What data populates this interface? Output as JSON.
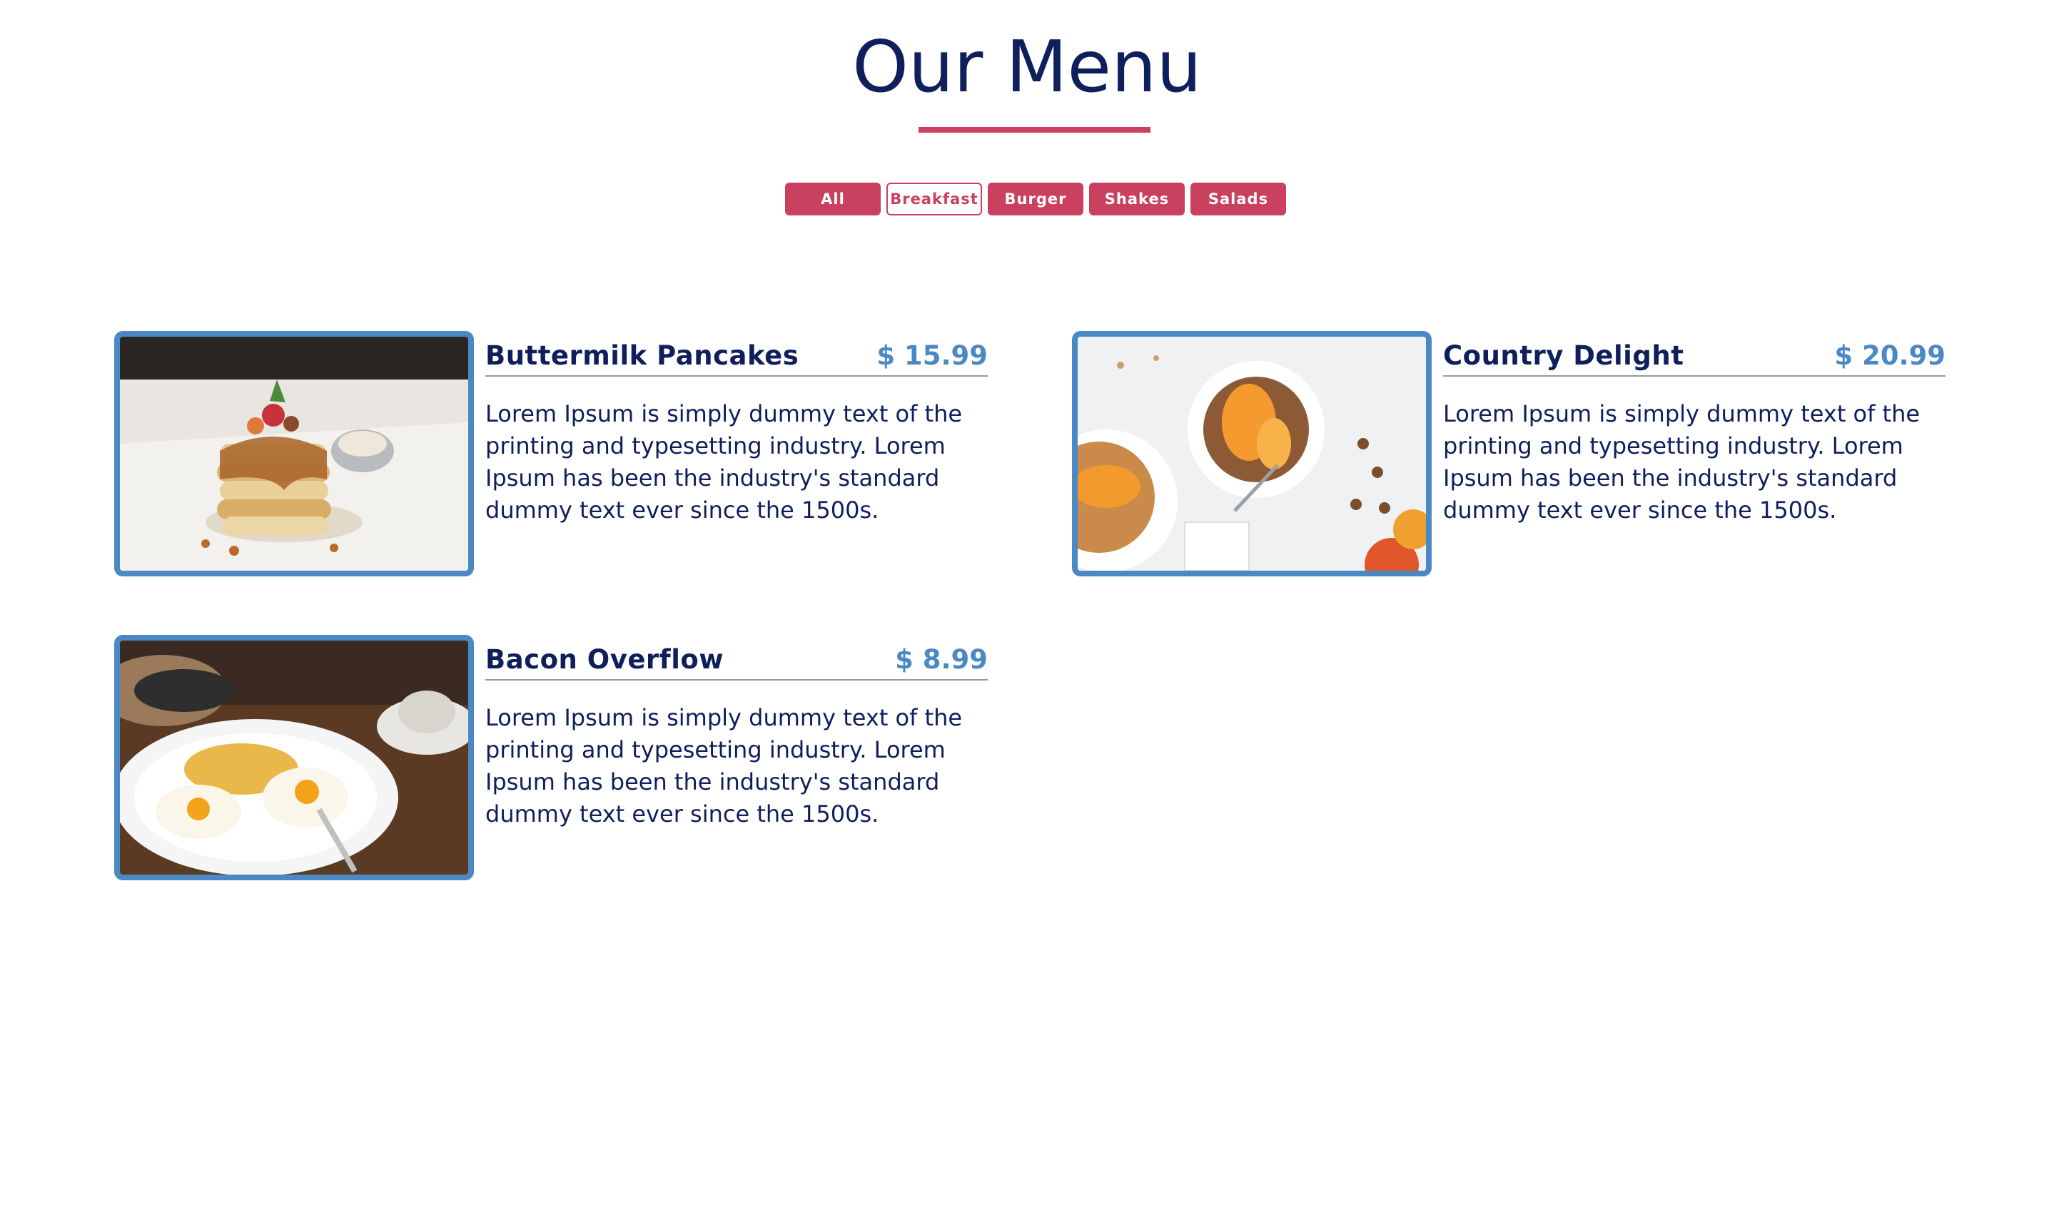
{
  "page_title": "Our Menu",
  "colors": {
    "heading": "#0f1f5c",
    "accent": "#c9415f",
    "price": "#4b89c5",
    "image_border": "#4b89c5"
  },
  "filters": [
    {
      "label": "All",
      "active": false
    },
    {
      "label": "Breakfast",
      "active": true
    },
    {
      "label": "Burger",
      "active": false
    },
    {
      "label": "Shakes",
      "active": false
    },
    {
      "label": "Salads",
      "active": false
    }
  ],
  "menu_items": [
    {
      "name": "Buttermilk Pancakes",
      "price": "$ 15.99",
      "description": "Lorem Ipsum is simply dummy text of the printing and typesetting industry. Lorem Ipsum has been the industry's standard dummy text ever since the 1500s.",
      "image": "pancakes-photo"
    },
    {
      "name": "Country Delight",
      "price": "$ 20.99",
      "description": "Lorem Ipsum is simply dummy text of the printing and typesetting industry. Lorem Ipsum has been the industry's standard dummy text ever since the 1500s.",
      "image": "fruit-bowls-photo"
    },
    {
      "name": "Bacon Overflow",
      "price": "$ 8.99",
      "description": "Lorem Ipsum is simply dummy text of the printing and typesetting industry. Lorem Ipsum has been the industry's standard dummy text ever since the 1500s.",
      "image": "eggs-breakfast-photo"
    }
  ]
}
